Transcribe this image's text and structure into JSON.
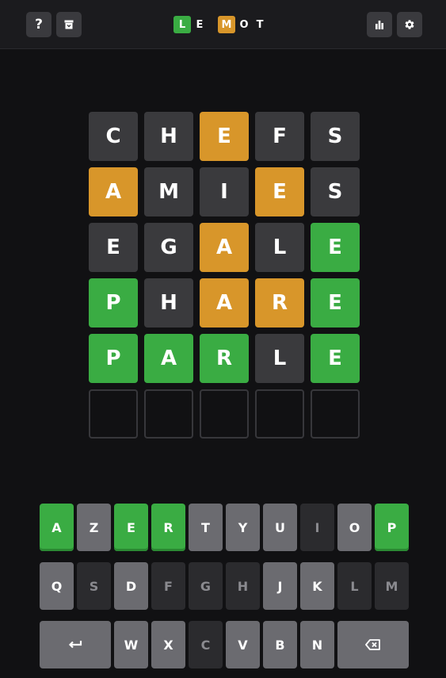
{
  "header": {
    "logo": [
      "L",
      "E",
      "M",
      "O",
      "T"
    ],
    "help_label": "?"
  },
  "colors": {
    "correct": "#3aac43",
    "present": "#d8962a",
    "absent_tile": "#3a3a3d",
    "key_unused": "#6b6b70",
    "key_absent": "#2b2b2e",
    "background": "#111113"
  },
  "board": [
    {
      "letters": [
        "C",
        "H",
        "E",
        "F",
        "S"
      ],
      "states": [
        "absent",
        "absent",
        "present",
        "absent",
        "absent"
      ]
    },
    {
      "letters": [
        "A",
        "M",
        "I",
        "E",
        "S"
      ],
      "states": [
        "present",
        "absent",
        "absent",
        "present",
        "absent"
      ]
    },
    {
      "letters": [
        "E",
        "G",
        "A",
        "L",
        "E"
      ],
      "states": [
        "absent",
        "absent",
        "present",
        "absent",
        "correct"
      ]
    },
    {
      "letters": [
        "P",
        "H",
        "A",
        "R",
        "E"
      ],
      "states": [
        "correct",
        "absent",
        "present",
        "present",
        "correct"
      ]
    },
    {
      "letters": [
        "P",
        "A",
        "R",
        "L",
        "E"
      ],
      "states": [
        "correct",
        "correct",
        "correct",
        "absent",
        "correct"
      ]
    },
    {
      "letters": [
        "",
        "",
        "",
        "",
        ""
      ],
      "states": [
        "empty",
        "empty",
        "empty",
        "empty",
        "empty"
      ]
    }
  ],
  "keyboard": {
    "row1": [
      {
        "key": "A",
        "state": "correct"
      },
      {
        "key": "Z",
        "state": "unused"
      },
      {
        "key": "E",
        "state": "correct"
      },
      {
        "key": "R",
        "state": "correct"
      },
      {
        "key": "T",
        "state": "unused"
      },
      {
        "key": "Y",
        "state": "unused"
      },
      {
        "key": "U",
        "state": "unused"
      },
      {
        "key": "I",
        "state": "absent"
      },
      {
        "key": "O",
        "state": "unused"
      },
      {
        "key": "P",
        "state": "correct"
      }
    ],
    "row2": [
      {
        "key": "Q",
        "state": "unused"
      },
      {
        "key": "S",
        "state": "absent"
      },
      {
        "key": "D",
        "state": "unused"
      },
      {
        "key": "F",
        "state": "absent"
      },
      {
        "key": "G",
        "state": "absent"
      },
      {
        "key": "H",
        "state": "absent"
      },
      {
        "key": "J",
        "state": "unused"
      },
      {
        "key": "K",
        "state": "unused"
      },
      {
        "key": "L",
        "state": "absent"
      },
      {
        "key": "M",
        "state": "absent"
      }
    ],
    "row3": [
      {
        "key": "enter",
        "state": "unused",
        "icon": "enter-icon"
      },
      {
        "key": "W",
        "state": "unused"
      },
      {
        "key": "X",
        "state": "unused"
      },
      {
        "key": "C",
        "state": "absent"
      },
      {
        "key": "V",
        "state": "unused"
      },
      {
        "key": "B",
        "state": "unused"
      },
      {
        "key": "N",
        "state": "unused"
      },
      {
        "key": "backspace",
        "state": "unused",
        "icon": "backspace-icon"
      }
    ]
  }
}
